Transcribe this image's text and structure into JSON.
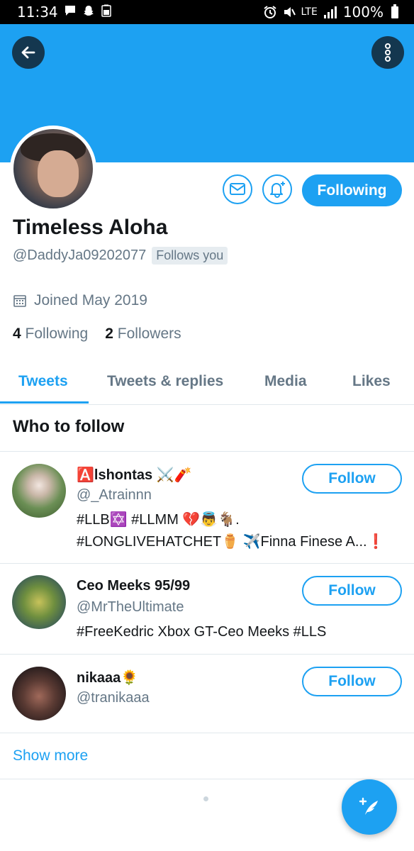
{
  "status_bar": {
    "time": "11:34",
    "left_icons": [
      "message-icon",
      "snapchat-icon",
      "battery-saver-icon"
    ],
    "lte_label": "LTE",
    "battery": "100%"
  },
  "header": {
    "back_icon": "arrow-left-icon",
    "more_icon": "more-vertical-icon",
    "banner_color": "#1da1f2"
  },
  "profile": {
    "display_name": "Timeless Aloha",
    "handle": "@DaddyJa09202077",
    "follows_you_badge": "Follows you",
    "joined": "Joined May 2019",
    "following_count": "4",
    "following_label": "Following",
    "followers_count": "2",
    "followers_label": "Followers",
    "following_button": "Following"
  },
  "tabs": [
    {
      "label": "Tweets",
      "active": true
    },
    {
      "label": "Tweets & replies",
      "active": false
    },
    {
      "label": "Media",
      "active": false
    },
    {
      "label": "Likes",
      "active": false
    }
  ],
  "who_to_follow": {
    "header": "Who to follow",
    "users": [
      {
        "name": "🅰️lshontas ⚔️🧨",
        "handle": "@_Atrainnn",
        "bio_line1": "#LLB✡️ #LLMM 💔👼🐐.",
        "bio_line2": "#LONGLIVEHATCHET⚱️ ✈️Finna Finese A...❗",
        "button": "Follow"
      },
      {
        "name": "Ceo Meeks 95/99",
        "handle": "@MrTheUltimate",
        "bio_line1": "#FreeKedric Xbox GT-Ceo Meeks #LLS",
        "button": "Follow"
      },
      {
        "name": "nikaaa🌻",
        "handle": "@tranikaaa",
        "button": "Follow"
      }
    ],
    "show_more": "Show more"
  },
  "fab": {
    "icon": "compose-tweet-icon"
  },
  "colors": {
    "accent": "#1da1f2",
    "text": "#14171a",
    "secondary": "#657786"
  }
}
